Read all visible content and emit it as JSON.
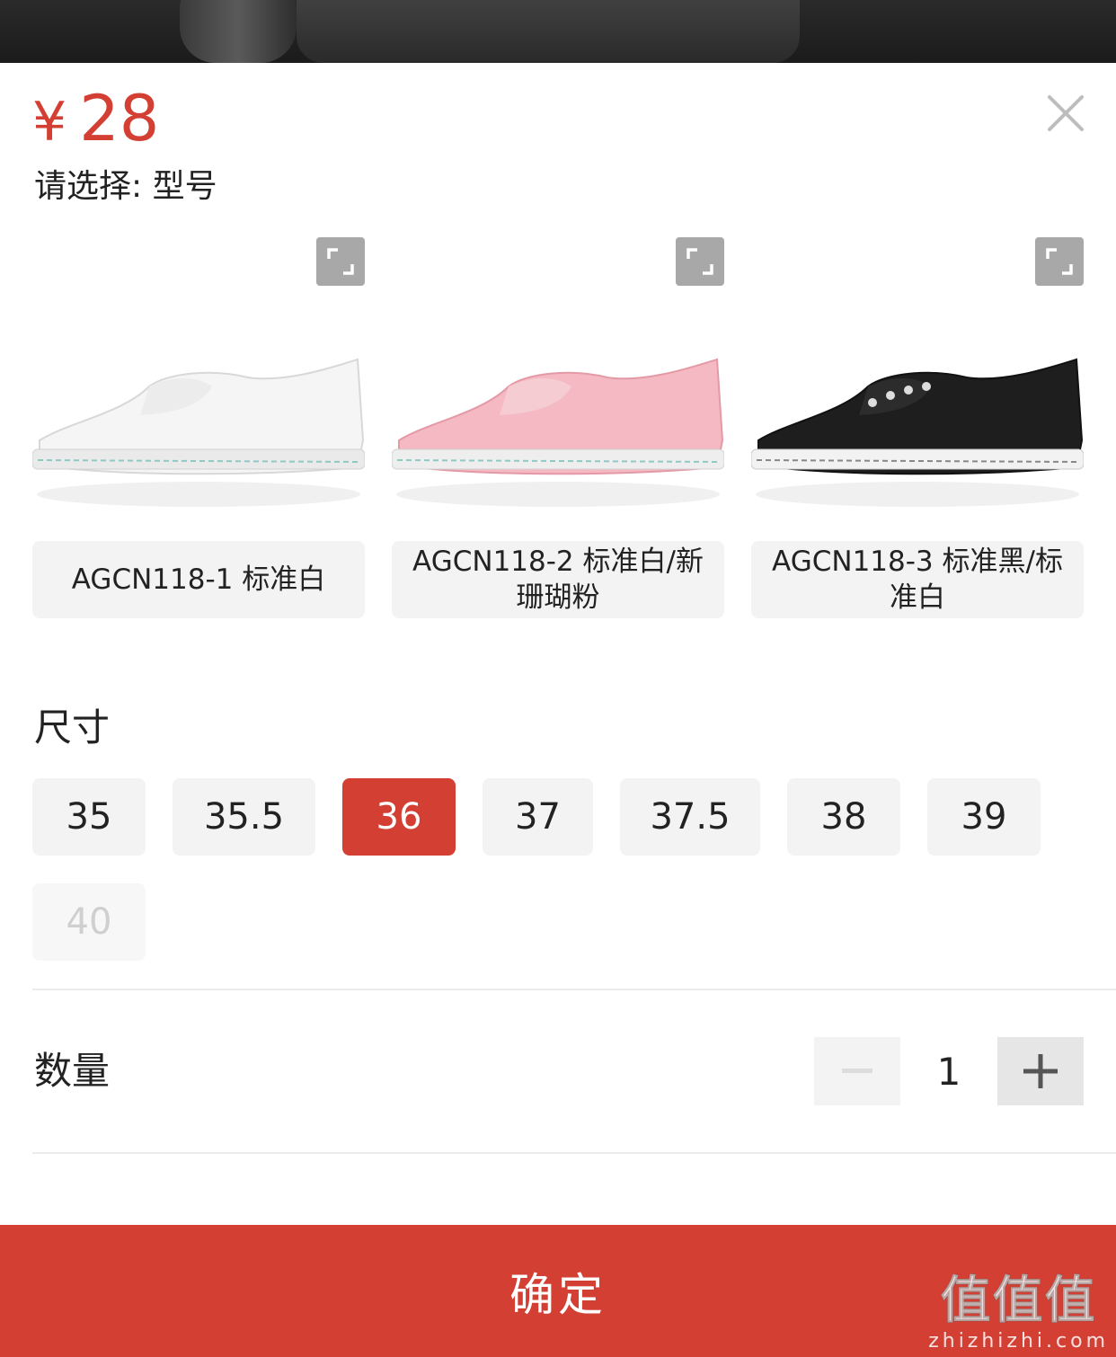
{
  "product": {
    "currency": "¥",
    "price": "28",
    "prompt": "请选择: 型号"
  },
  "models": [
    {
      "label": "AGCN118-1 标准白",
      "color": "#ffffff",
      "icon": "expand-icon"
    },
    {
      "label": "AGCN118-2 标准白/新珊瑚粉",
      "color": "#f3b8c0",
      "icon": "expand-icon"
    },
    {
      "label": "AGCN118-3 标准黑/标准白",
      "color": "#1e1e1e",
      "icon": "expand-icon"
    }
  ],
  "size_section": {
    "title": "尺寸",
    "options": [
      "35",
      "35.5",
      "36",
      "37",
      "37.5",
      "38",
      "39",
      "40"
    ],
    "selected": "36",
    "disabled": [
      "40"
    ]
  },
  "quantity": {
    "title": "数量",
    "value": "1",
    "minus": "−",
    "plus": "+"
  },
  "confirm_label": "确定",
  "watermark": {
    "main": "值值值",
    "site": "zhizhizhi.com"
  },
  "colors": {
    "accent": "#d33f33",
    "chip_bg": "#f3f3f3"
  }
}
